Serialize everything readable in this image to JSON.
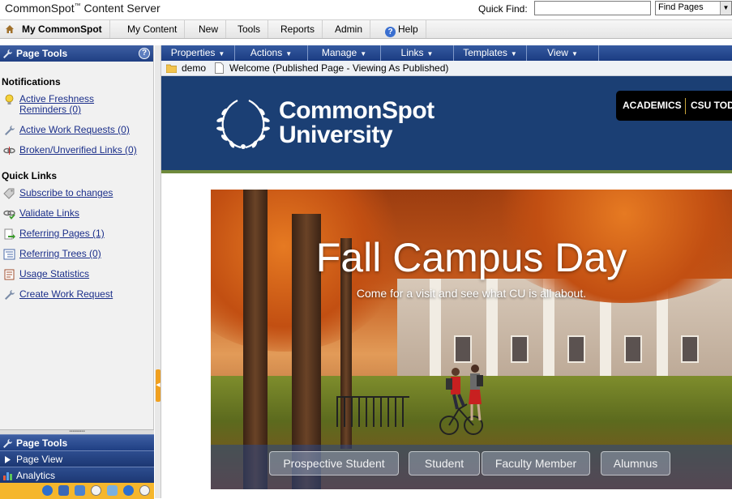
{
  "app": {
    "brand": "CommonSpot",
    "brand_tm": "™",
    "brand_product": " Content Server"
  },
  "quick_find": {
    "label": "Quick Find:",
    "value": "",
    "select_value": "Find Pages"
  },
  "menu": {
    "items": [
      "My CommonSpot",
      "My Content",
      "New",
      "Tools",
      "Reports",
      "Admin",
      "Help"
    ]
  },
  "left_panel": {
    "title": "Page Tools",
    "notifications_heading": "Notifications",
    "notifications": [
      {
        "label_line1": "Active Freshness",
        "label_line2": "Reminders (0)",
        "icon": "lightbulb-icon"
      },
      {
        "label": "Active Work Requests (0)",
        "icon": "wrench-icon"
      },
      {
        "label": "Broken/Unverified Links (0)",
        "icon": "broken-link-icon"
      }
    ],
    "quick_links_heading": "Quick Links",
    "quick_links": [
      {
        "label": "Subscribe to changes",
        "icon": "tag-icon"
      },
      {
        "label": "Validate Links",
        "icon": "link-check-icon"
      },
      {
        "label": "Referring Pages (1)",
        "icon": "referring-page-icon"
      },
      {
        "label": "Referring Trees (0)",
        "icon": "tree-icon"
      },
      {
        "label": "Usage Statistics",
        "icon": "statistics-icon"
      },
      {
        "label": "Create Work Request",
        "icon": "wrench-icon"
      }
    ],
    "bottom_tabs": [
      {
        "label": "Page Tools",
        "active": true
      },
      {
        "label": "Page View",
        "active": false
      },
      {
        "label": "Analytics",
        "active": false
      }
    ]
  },
  "page_toolbar": {
    "items": [
      "Properties",
      "Actions",
      "Manage",
      "Links",
      "Templates",
      "View"
    ]
  },
  "breadcrumb": {
    "folder": "demo",
    "page": "Welcome (Published Page - Viewing As Published)"
  },
  "site": {
    "logo_line1": "CommonSpot",
    "logo_line2": "University",
    "nav_items": [
      "ACADEMICS",
      "CSU TOD"
    ],
    "header_color": "#1b3f74",
    "accent_line_color": "#6f8a3c"
  },
  "hero": {
    "title": "Fall Campus Day",
    "subtitle": "Come for a visit and see what CU is all about.",
    "buttons": [
      "Prospective Student",
      "Student",
      "Faculty Member",
      "Alumnus"
    ]
  },
  "colors": {
    "panel_header": "#2a4b92",
    "toolbar_orange": "#f5b62c",
    "link_blue": "#1b2f8a"
  }
}
